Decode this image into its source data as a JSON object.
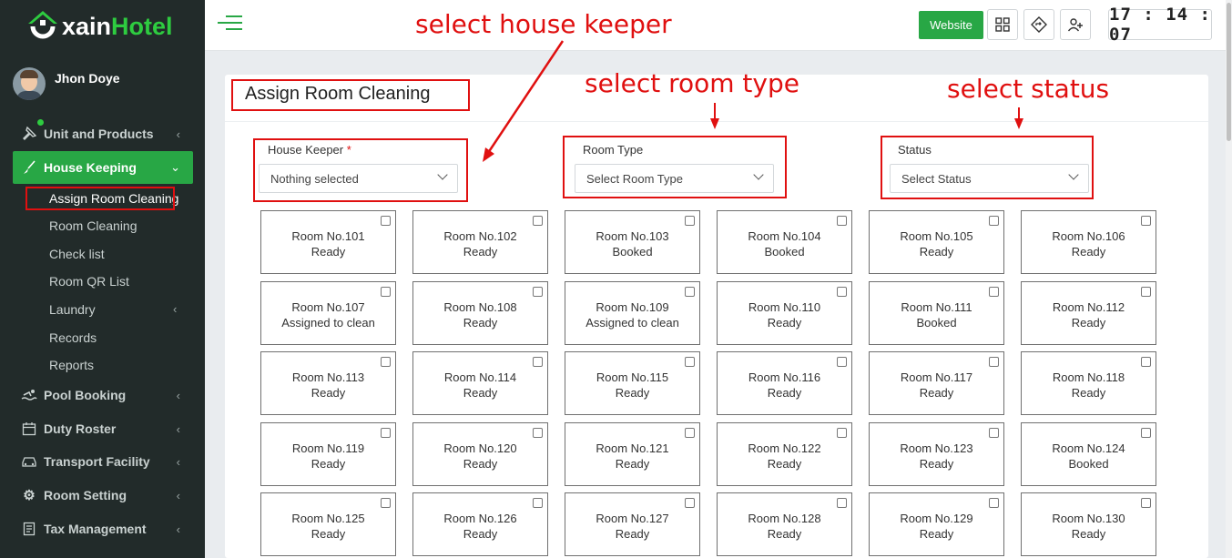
{
  "app": {
    "logo_prefix": "xain",
    "logo_accent": "Hotel",
    "accent_color": "#28a745",
    "annotation_color": "#e01010"
  },
  "user": {
    "name": "Jhon Doye"
  },
  "sidebar": {
    "items": [
      {
        "label": "Unit and Products",
        "icon": "pin-icon"
      },
      {
        "label": "House Keeping",
        "icon": "broom-icon",
        "active": true
      },
      {
        "label": "Pool Booking",
        "icon": "swimmer-icon"
      },
      {
        "label": "Duty Roster",
        "icon": "calendar-icon"
      },
      {
        "label": "Transport Facility",
        "icon": "car-icon"
      },
      {
        "label": "Room Setting",
        "icon": "gear-icon"
      },
      {
        "label": "Tax Management",
        "icon": "file-icon"
      }
    ],
    "sub_items": [
      "Assign Room Cleaning",
      "Room Cleaning",
      "Check list",
      "Room QR List",
      "Laundry",
      "Records",
      "Reports"
    ]
  },
  "topbar": {
    "website_label": "Website",
    "clock": "17 : 14 : 07"
  },
  "page": {
    "title": "Assign Room Cleaning"
  },
  "filters": {
    "house_keeper": {
      "label": "House Keeper",
      "required_mark": "*",
      "value": "Nothing selected"
    },
    "room_type": {
      "label": "Room Type",
      "value": "Select Room Type"
    },
    "status": {
      "label": "Status",
      "value": "Select Status"
    }
  },
  "annotations": {
    "house_keeper": "select house keeper",
    "room_type": "select room type",
    "status": "select status"
  },
  "rooms": [
    {
      "name": "Room No.101",
      "status": "Ready"
    },
    {
      "name": "Room No.102",
      "status": "Ready"
    },
    {
      "name": "Room No.103",
      "status": "Booked"
    },
    {
      "name": "Room No.104",
      "status": "Booked"
    },
    {
      "name": "Room No.105",
      "status": "Ready"
    },
    {
      "name": "Room No.106",
      "status": "Ready"
    },
    {
      "name": "Room No.107",
      "status": "Assigned to clean"
    },
    {
      "name": "Room No.108",
      "status": "Ready"
    },
    {
      "name": "Room No.109",
      "status": "Assigned to clean"
    },
    {
      "name": "Room No.110",
      "status": "Ready"
    },
    {
      "name": "Room No.111",
      "status": "Booked"
    },
    {
      "name": "Room No.112",
      "status": "Ready"
    },
    {
      "name": "Room No.113",
      "status": "Ready"
    },
    {
      "name": "Room No.114",
      "status": "Ready"
    },
    {
      "name": "Room No.115",
      "status": "Ready"
    },
    {
      "name": "Room No.116",
      "status": "Ready"
    },
    {
      "name": "Room No.117",
      "status": "Ready"
    },
    {
      "name": "Room No.118",
      "status": "Ready"
    },
    {
      "name": "Room No.119",
      "status": "Ready"
    },
    {
      "name": "Room No.120",
      "status": "Ready"
    },
    {
      "name": "Room No.121",
      "status": "Ready"
    },
    {
      "name": "Room No.122",
      "status": "Ready"
    },
    {
      "name": "Room No.123",
      "status": "Ready"
    },
    {
      "name": "Room No.124",
      "status": "Booked"
    },
    {
      "name": "Room No.125",
      "status": "Ready"
    },
    {
      "name": "Room No.126",
      "status": "Ready"
    },
    {
      "name": "Room No.127",
      "status": "Ready"
    },
    {
      "name": "Room No.128",
      "status": "Ready"
    },
    {
      "name": "Room No.129",
      "status": "Ready"
    },
    {
      "name": "Room No.130",
      "status": "Ready"
    }
  ]
}
